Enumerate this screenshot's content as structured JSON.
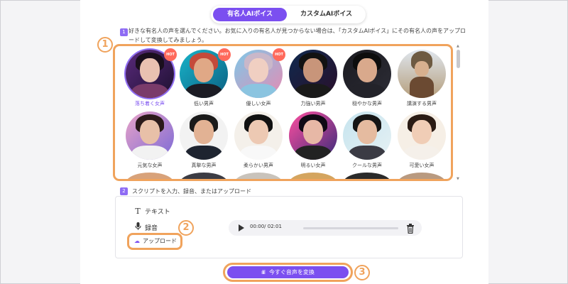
{
  "tabs": [
    {
      "label": "有名人AIボイス",
      "active": true
    },
    {
      "label": "カスタムAIボイス",
      "active": false
    }
  ],
  "step1": {
    "number": "1",
    "instruction": "好きな有名人の声を選んでください。お気に入りの有名人が見つからない場合は、「カスタムAIボイス」にその有名人の声をアップロードして変換してみましょう。"
  },
  "voices": [
    {
      "label": "落ち着く女声",
      "selected": true,
      "hot": true
    },
    {
      "label": "低い男声",
      "selected": false,
      "hot": true
    },
    {
      "label": "優しい女声",
      "selected": false,
      "hot": true
    },
    {
      "label": "力強い男声",
      "selected": false,
      "hot": false
    },
    {
      "label": "穏やかな男声",
      "selected": false,
      "hot": false
    },
    {
      "label": "講演する男声",
      "selected": false,
      "hot": false
    },
    {
      "label": "元気な女声",
      "selected": false,
      "hot": false
    },
    {
      "label": "真摯な男声",
      "selected": false,
      "hot": false
    },
    {
      "label": "柔らかい男声",
      "selected": false,
      "hot": false
    },
    {
      "label": "明るい女声",
      "selected": false,
      "hot": false
    },
    {
      "label": "クールな男声",
      "selected": false,
      "hot": false
    },
    {
      "label": "可愛い女声",
      "selected": false,
      "hot": false
    }
  ],
  "hot_badge": "HOT",
  "step2": {
    "number": "2",
    "instruction": "スクリプトを入力、録音、またはアップロード",
    "options": [
      {
        "label": "テキスト",
        "icon": "text-icon"
      },
      {
        "label": "録音",
        "icon": "microphone-icon"
      },
      {
        "label": "アップロード",
        "icon": "cloud-upload-icon",
        "active": true
      }
    ]
  },
  "player": {
    "time": "00:00/ 02:01"
  },
  "convert_button": "今すぐ音声を変換",
  "callouts": [
    "1",
    "2",
    "3"
  ],
  "colors": {
    "accent": "#7b4ff0",
    "callout": "#f0a35c",
    "hot": "#ff6a5c"
  }
}
